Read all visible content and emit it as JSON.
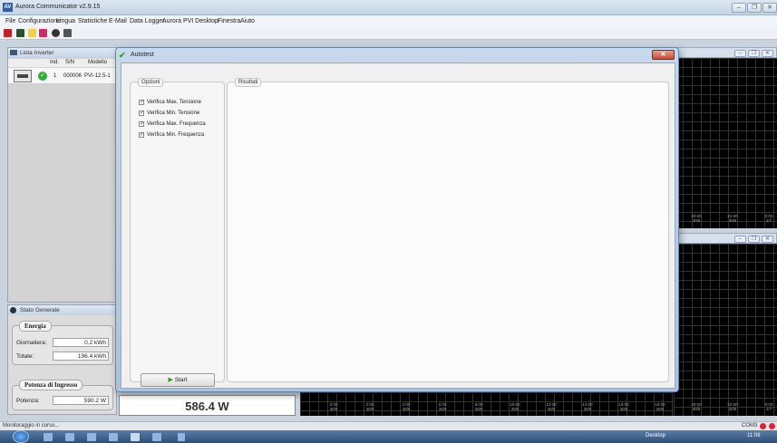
{
  "app": {
    "title": "Aurora Communicator v2.9.15"
  },
  "menu": [
    "File",
    "Configurazione",
    "Lingua",
    "Statistiche",
    "E-Mail",
    "Data Logger",
    "Aurora PVI Desktop",
    "Finestra",
    "Aiuto"
  ],
  "inverter_list": {
    "title": "Lista Inverter",
    "columns": [
      "Ind.",
      "S/N",
      "Modello"
    ],
    "row": {
      "address": "1",
      "serial": "000006",
      "model": "PVI-12.5-1"
    }
  },
  "stato": {
    "title": "Stato Generale",
    "energia_title": "Energia",
    "giornaliera_label": "Giornaliera:",
    "giornaliera_value": "0.2 kWh",
    "totale_label": "Totale:",
    "totale_value": "196.4 kWh",
    "potenza_title": "Potenza di Ingresso",
    "potenza_label": "Potenza:",
    "potenza_value": "590.2 W"
  },
  "power_display": "586.4 W",
  "chart_ticks": [
    {
      "t": "0:00",
      "d": "30/6"
    },
    {
      "t": "2:00",
      "d": "30/6"
    },
    {
      "t": "4:00",
      "d": "30/6"
    },
    {
      "t": "6:00",
      "d": "30/6"
    },
    {
      "t": "8:00",
      "d": "30/6"
    },
    {
      "t": "10:00",
      "d": "30/6"
    },
    {
      "t": "12:00",
      "d": "30/6"
    },
    {
      "t": "14:00",
      "d": "30/6"
    },
    {
      "t": "16:00",
      "d": "30/6"
    },
    {
      "t": "18:00",
      "d": "30/6"
    },
    {
      "t": "20:00",
      "d": "30/6"
    },
    {
      "t": "22:00",
      "d": "30/6"
    },
    {
      "t": "0:00",
      "d": "1/7"
    }
  ],
  "dialog": {
    "title": "Autotest",
    "opzioni_label": "Opzioni",
    "risultati_label": "Risultati",
    "checks": [
      "Verifica Max. Tensione",
      "Verifica Min. Tensione",
      "Verifica Max. Frequenza",
      "Verifica Min. Frequenza"
    ],
    "start_label": "Start"
  },
  "statusbar": {
    "message": "Monitoraggio in corso...",
    "port": "COM3"
  },
  "taskbar": {
    "desktop": "Desktop",
    "clock": "11:06"
  },
  "colors": {
    "ok_green": "#2fae38",
    "chart_bg": "#000000",
    "dialog_close": "#c74a33"
  }
}
